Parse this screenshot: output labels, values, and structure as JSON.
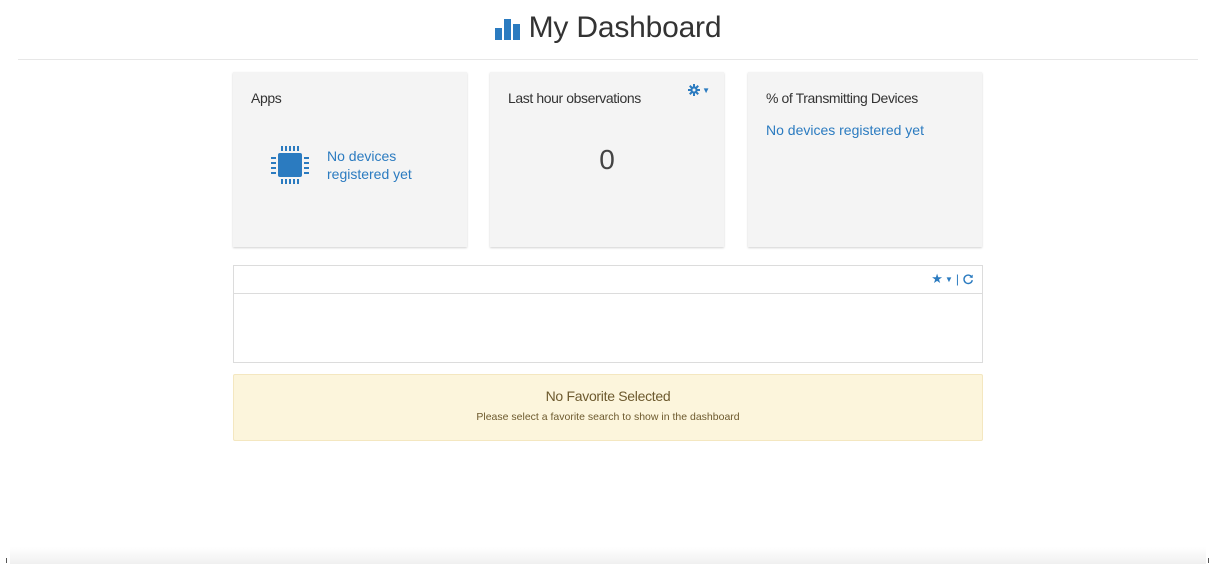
{
  "header": {
    "title": "My Dashboard",
    "icon": "bar-chart-icon",
    "accent_color": "#2b7bc0"
  },
  "cards": {
    "apps": {
      "title": "Apps",
      "icon": "chip-icon",
      "message": "No devices registered yet"
    },
    "observations": {
      "title": "Last hour observations",
      "value": "0",
      "settings_icon": "gear-icon"
    },
    "transmitting": {
      "title": "% of Transmitting Devices",
      "message": "No devices registered yet"
    }
  },
  "favorites_panel": {
    "tools": {
      "star_icon": "star-icon",
      "separator": "|",
      "refresh_icon": "refresh-icon"
    }
  },
  "alert": {
    "title": "No Favorite Selected",
    "message": "Please select a favorite search to show in the dashboard",
    "background_color": "#fcf5dc"
  }
}
